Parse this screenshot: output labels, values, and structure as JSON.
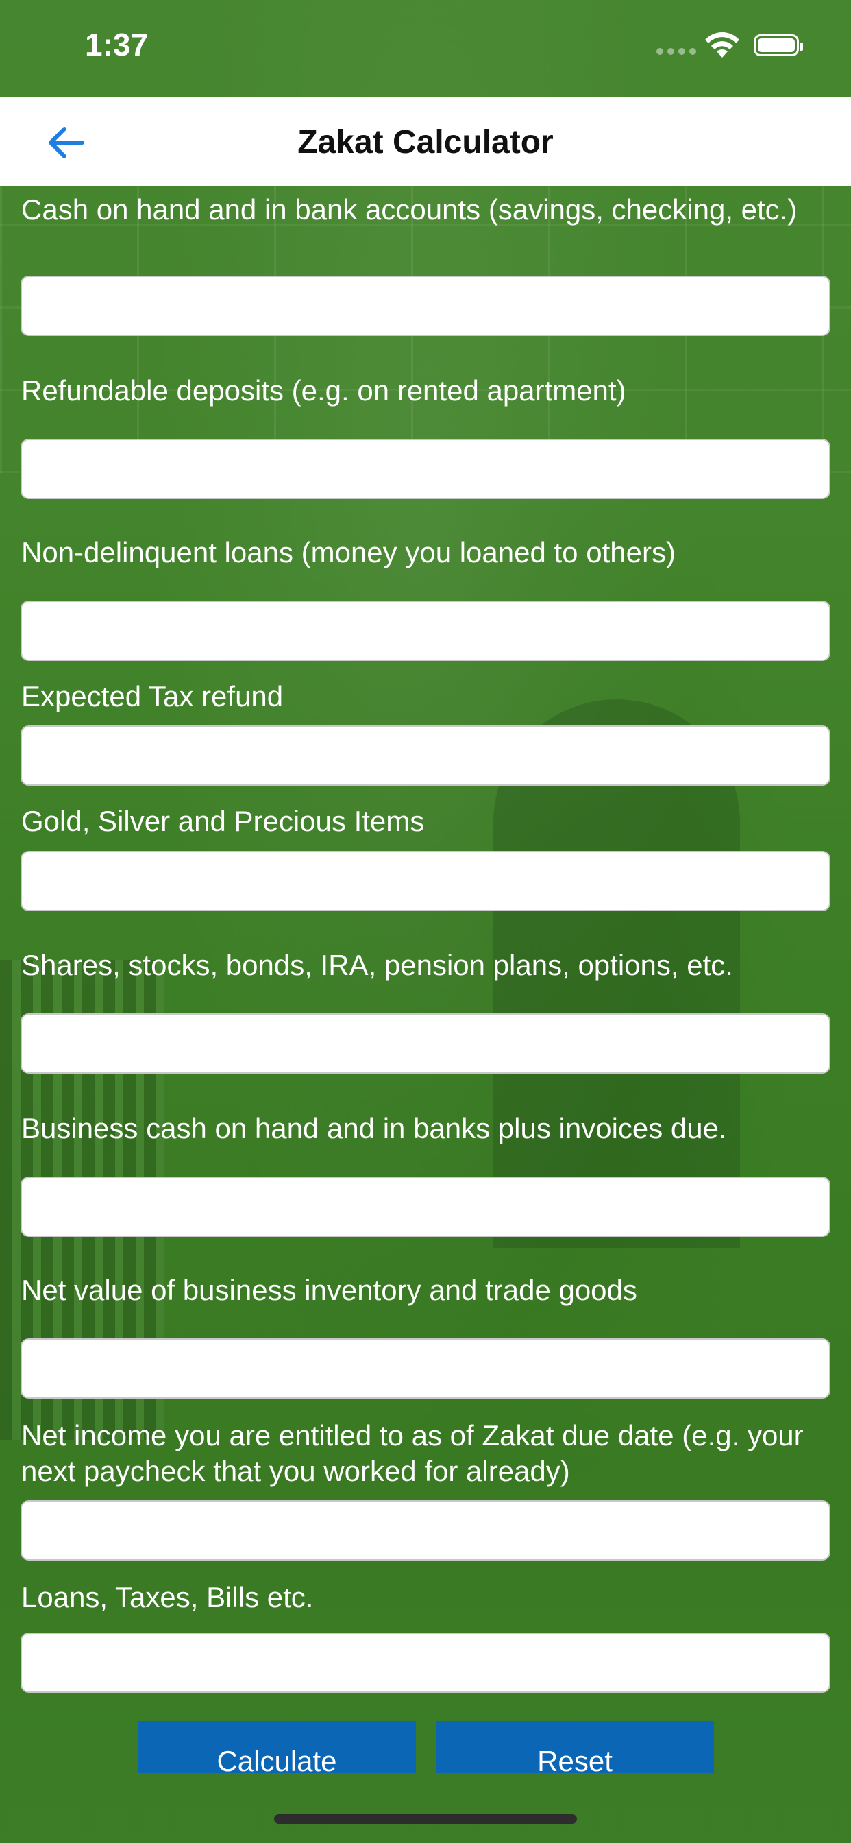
{
  "status_bar": {
    "time": "1:37"
  },
  "navbar": {
    "title": "Zakat Calculator",
    "back_icon": "arrow-left-icon",
    "accent_color": "#1e7fe0"
  },
  "form": {
    "fields": [
      {
        "label": "Cash on hand and in bank accounts (savings, checking, etc.)",
        "value": "",
        "placeholder": ""
      },
      {
        "label": "Refundable deposits (e.g. on rented apartment)",
        "value": "",
        "placeholder": ""
      },
      {
        "label": "Non-delinquent loans (money you loaned to others)",
        "value": "",
        "placeholder": ""
      },
      {
        "label": "Expected Tax refund",
        "value": "",
        "placeholder": ""
      },
      {
        "label": "Gold, Silver and Precious Items",
        "value": "",
        "placeholder": ""
      },
      {
        "label": "Shares, stocks, bonds, IRA, pension plans, options, etc.",
        "value": "",
        "placeholder": ""
      },
      {
        "label": "Business cash on hand and in banks plus invoices due.",
        "value": "",
        "placeholder": ""
      },
      {
        "label": "Net value of business inventory and trade goods",
        "value": "",
        "placeholder": ""
      },
      {
        "label": "Net income you are entitled to as of Zakat due date (e.g. your next paycheck that you worked for already)",
        "value": "",
        "placeholder": ""
      },
      {
        "label": "Loans, Taxes, Bills etc.",
        "value": "",
        "placeholder": ""
      }
    ]
  },
  "actions": {
    "calculate_label": "Calculate",
    "reset_label": "Reset",
    "button_color": "#0b66b5"
  }
}
